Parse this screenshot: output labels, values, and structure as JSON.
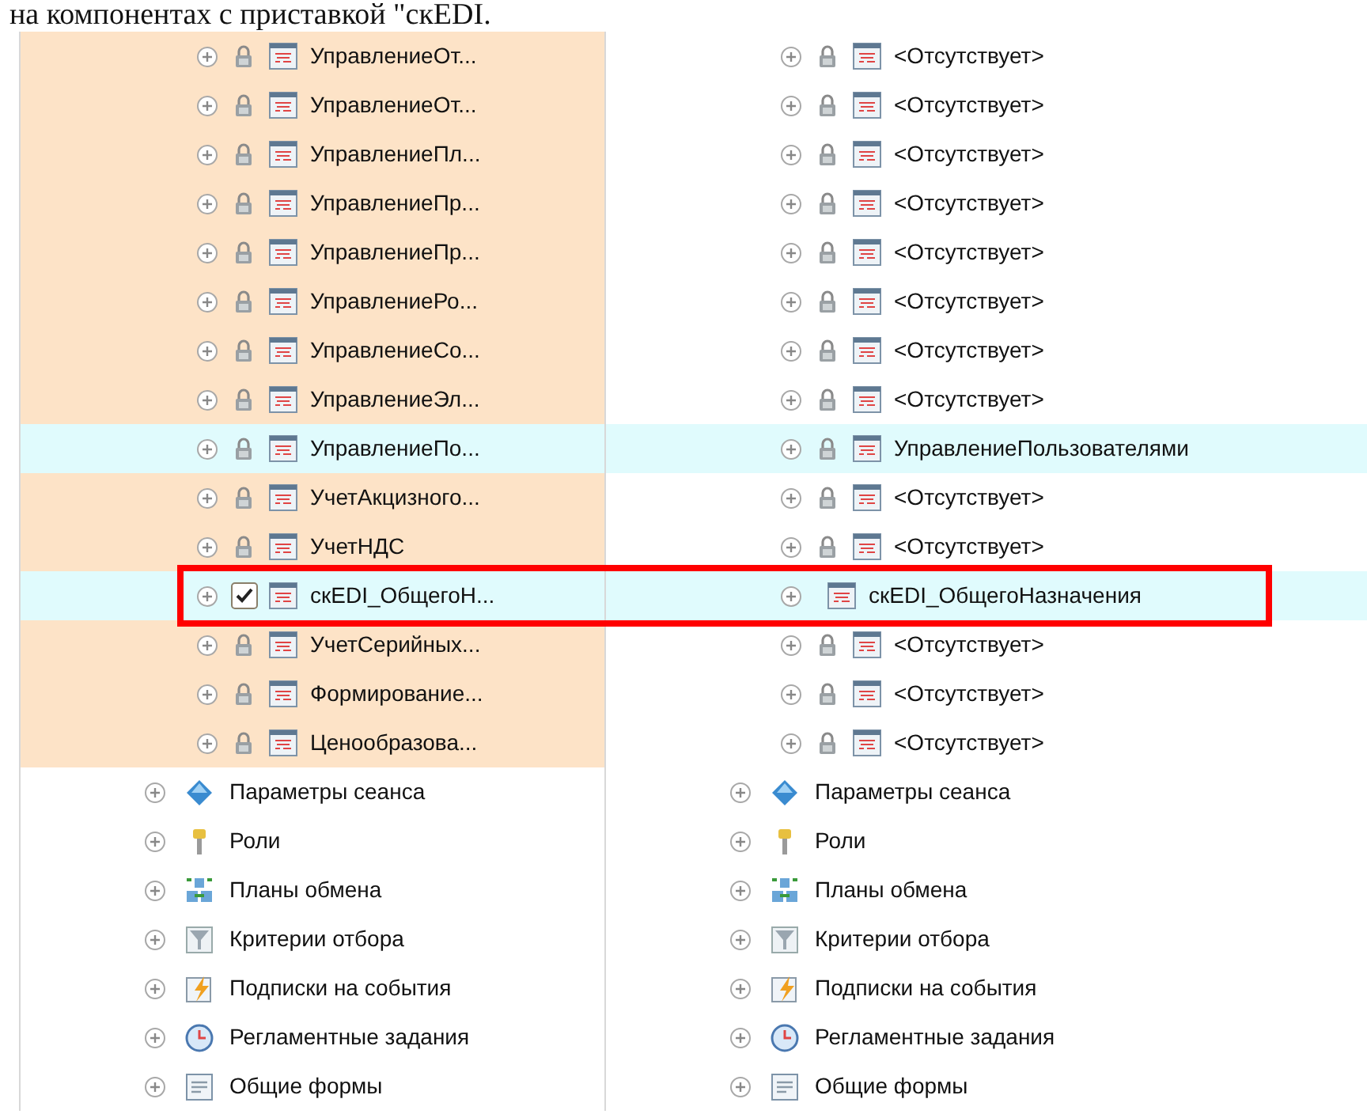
{
  "caption": "на компонентах с приставкой \"скEDI.",
  "rows": [
    {
      "highlighted": false,
      "framed": false,
      "left": {
        "kind": "locked",
        "text": "УправлениеОт..."
      },
      "right": {
        "kind": "locked",
        "text": "<Отсутствует>"
      }
    },
    {
      "highlighted": false,
      "framed": false,
      "left": {
        "kind": "locked",
        "text": "УправлениеОт..."
      },
      "right": {
        "kind": "locked",
        "text": "<Отсутствует>"
      }
    },
    {
      "highlighted": false,
      "framed": false,
      "left": {
        "kind": "locked",
        "text": "УправлениеПл..."
      },
      "right": {
        "kind": "locked",
        "text": "<Отсутствует>"
      }
    },
    {
      "highlighted": false,
      "framed": false,
      "left": {
        "kind": "locked",
        "text": "УправлениеПр..."
      },
      "right": {
        "kind": "locked",
        "text": "<Отсутствует>"
      }
    },
    {
      "highlighted": false,
      "framed": false,
      "left": {
        "kind": "locked",
        "text": "УправлениеПр..."
      },
      "right": {
        "kind": "locked",
        "text": "<Отсутствует>"
      }
    },
    {
      "highlighted": false,
      "framed": false,
      "left": {
        "kind": "locked",
        "text": "УправлениеРо..."
      },
      "right": {
        "kind": "locked",
        "text": "<Отсутствует>"
      }
    },
    {
      "highlighted": false,
      "framed": false,
      "left": {
        "kind": "locked",
        "text": "УправлениеСо..."
      },
      "right": {
        "kind": "locked",
        "text": "<Отсутствует>"
      }
    },
    {
      "highlighted": false,
      "framed": false,
      "left": {
        "kind": "locked",
        "text": "УправлениеЭл..."
      },
      "right": {
        "kind": "locked",
        "text": "<Отсутствует>"
      }
    },
    {
      "highlighted": true,
      "framed": false,
      "left": {
        "kind": "locked",
        "text": "УправлениеПо..."
      },
      "right": {
        "kind": "locked",
        "text": "УправлениеПользователями"
      }
    },
    {
      "highlighted": false,
      "framed": false,
      "left": {
        "kind": "locked",
        "text": "УчетАкцизного..."
      },
      "right": {
        "kind": "locked",
        "text": "<Отсутствует>"
      }
    },
    {
      "highlighted": false,
      "framed": false,
      "left": {
        "kind": "locked",
        "text": "УчетНДС"
      },
      "right": {
        "kind": "locked",
        "text": "<Отсутствует>"
      }
    },
    {
      "highlighted": true,
      "framed": true,
      "left": {
        "kind": "checkbox",
        "checked": true,
        "text": "скEDI_ОбщегоН..."
      },
      "right": {
        "kind": "plain",
        "text": "скEDI_ОбщегоНазначения"
      }
    },
    {
      "highlighted": false,
      "framed": false,
      "left": {
        "kind": "locked",
        "text": "УчетСерийных..."
      },
      "right": {
        "kind": "locked",
        "text": "<Отсутствует>"
      }
    },
    {
      "highlighted": false,
      "framed": false,
      "left": {
        "kind": "locked",
        "text": "Формирование..."
      },
      "right": {
        "kind": "locked",
        "text": "<Отсутствует>"
      }
    },
    {
      "highlighted": false,
      "framed": false,
      "left": {
        "kind": "locked",
        "text": "Ценообразова..."
      },
      "right": {
        "kind": "locked",
        "text": "<Отсутствует>"
      }
    }
  ],
  "groups": [
    {
      "kind": "session-parameters",
      "left": "Параметры сеанса",
      "right": "Параметры сеанса"
    },
    {
      "kind": "roles",
      "left": "Роли",
      "right": "Роли"
    },
    {
      "kind": "exchange-plans",
      "left": "Планы обмена",
      "right": "Планы обмена"
    },
    {
      "kind": "filter-criteria",
      "left": "Критерии отбора",
      "right": "Критерии отбора"
    },
    {
      "kind": "event-subscriptions",
      "left": "Подписки на события",
      "right": "Подписки на события"
    },
    {
      "kind": "scheduled-jobs",
      "left": "Регламентные задания",
      "right": "Регламентные задания"
    },
    {
      "kind": "common-forms",
      "left": "Общие формы",
      "right": "Общие формы"
    }
  ]
}
